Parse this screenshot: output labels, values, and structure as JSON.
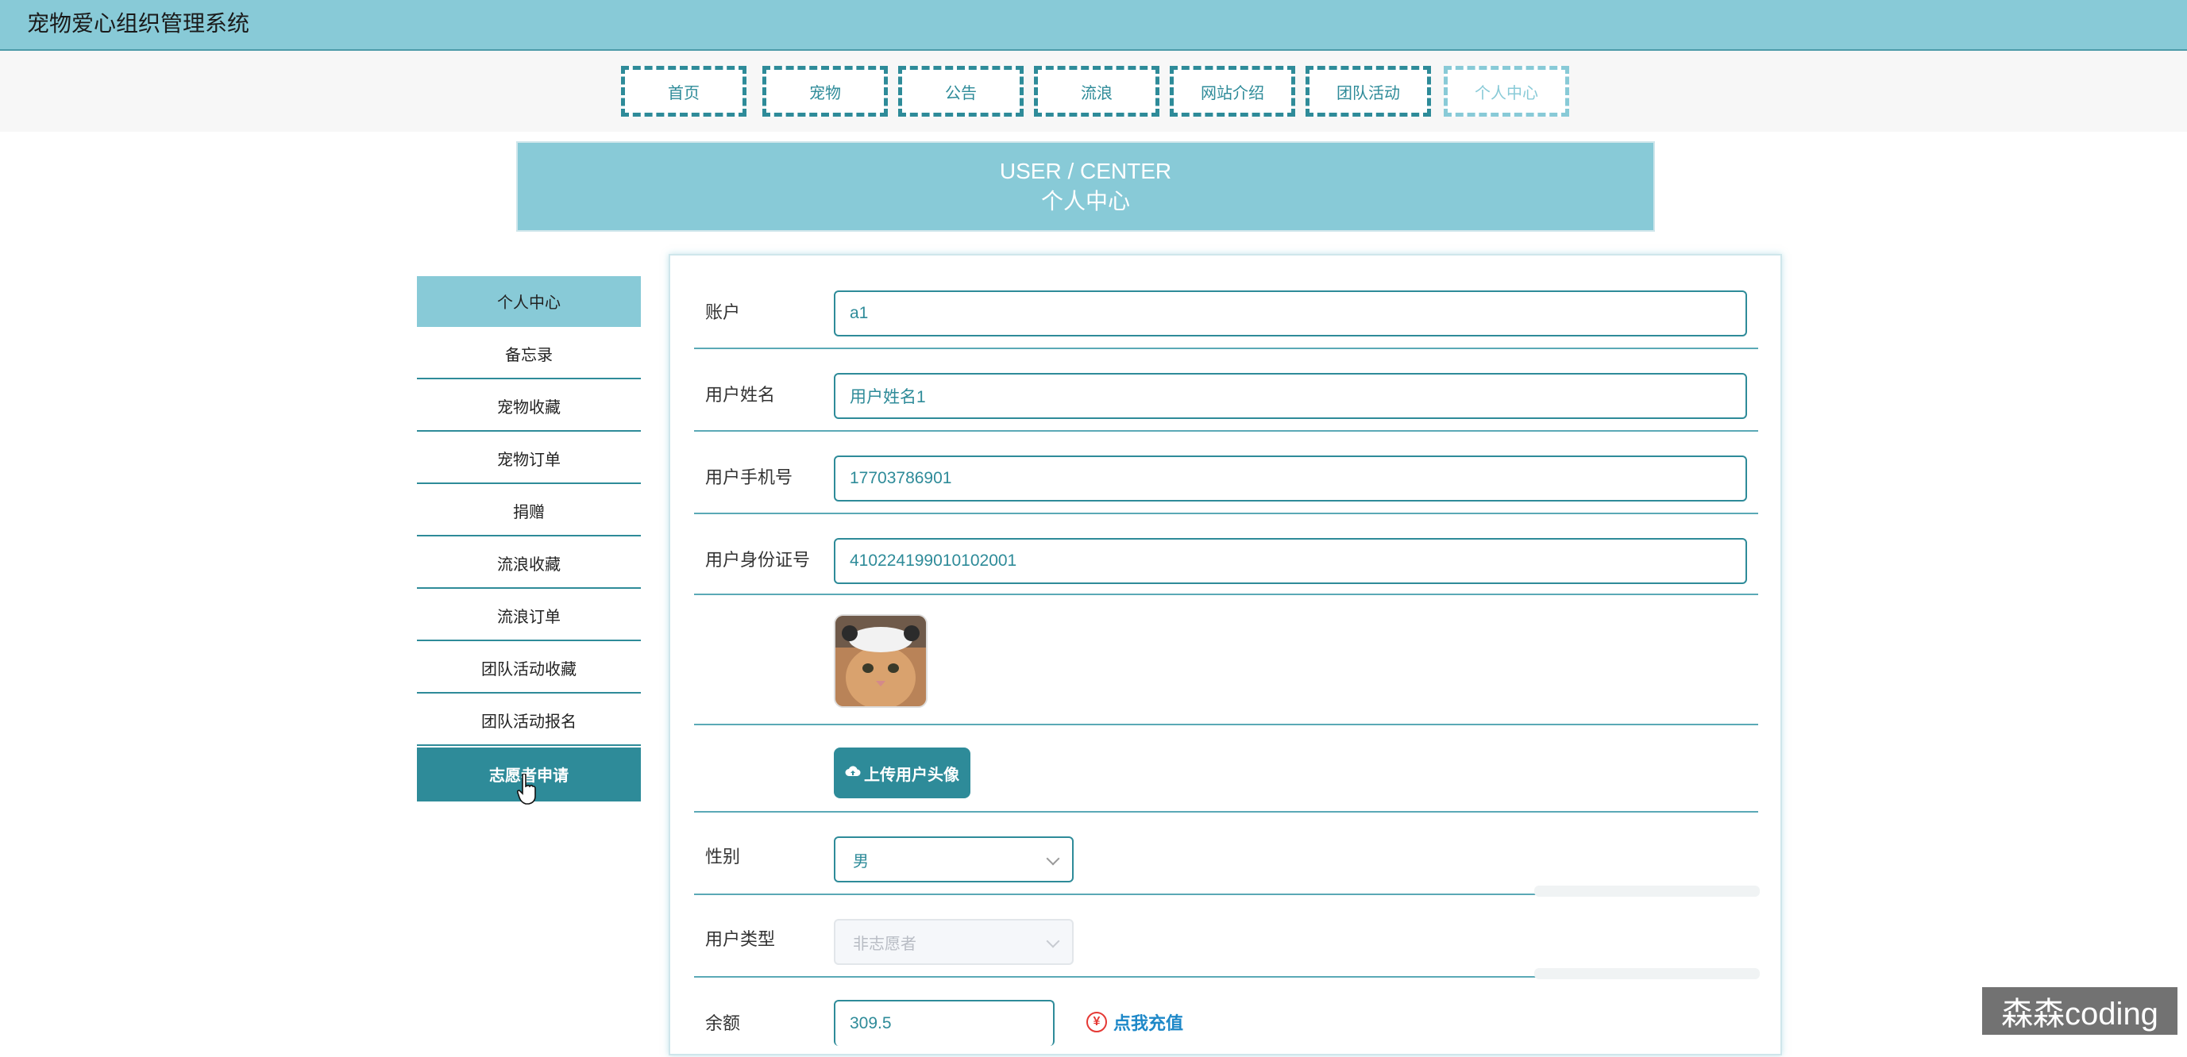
{
  "app": {
    "title": "宠物爱心组织管理系统"
  },
  "nav": {
    "items": [
      {
        "label": "首页"
      },
      {
        "label": "宠物"
      },
      {
        "label": "公告"
      },
      {
        "label": "流浪"
      },
      {
        "label": "网站介绍"
      },
      {
        "label": "团队活动"
      },
      {
        "label": "个人中心",
        "active": true
      }
    ]
  },
  "banner": {
    "title_en": "USER / CENTER",
    "title_cn": "个人中心"
  },
  "sidebar": {
    "items": [
      {
        "label": "个人中心",
        "state": "current"
      },
      {
        "label": "备忘录"
      },
      {
        "label": "宠物收藏"
      },
      {
        "label": "宠物订单"
      },
      {
        "label": "捐赠"
      },
      {
        "label": "流浪收藏"
      },
      {
        "label": "流浪订单"
      },
      {
        "label": "团队活动收藏"
      },
      {
        "label": "团队活动报名"
      },
      {
        "label": "志愿者申请",
        "state": "hover"
      }
    ]
  },
  "form": {
    "account": {
      "label": "账户",
      "value": "a1"
    },
    "username": {
      "label": "用户姓名",
      "value": "用户姓名1"
    },
    "phone": {
      "label": "用户手机号",
      "value": "17703786901"
    },
    "id_card": {
      "label": "用户身份证号",
      "value": "410224199010102001"
    },
    "upload_label": "上传用户头像",
    "gender": {
      "label": "性别",
      "value": "男"
    },
    "user_type": {
      "label": "用户类型",
      "value": "非志愿者"
    },
    "balance": {
      "label": "余额",
      "value": "309.5",
      "recharge_label": "点我充值"
    }
  },
  "watermark": "森森coding",
  "colors": {
    "primary": "#2e8b99",
    "light": "#88cad7",
    "link": "#1e88c8",
    "danger": "#e53935"
  }
}
